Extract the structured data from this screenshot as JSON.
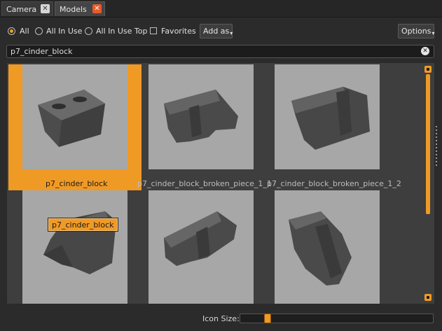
{
  "tabs": [
    {
      "label": "Camera",
      "close": "✕"
    },
    {
      "label": "Models",
      "close": "✕"
    }
  ],
  "filters": {
    "options": [
      {
        "label": "All",
        "selected": true
      },
      {
        "label": "All In Use",
        "selected": false
      },
      {
        "label": "All In Use Top",
        "selected": false
      }
    ],
    "favorites_label": "Favorites",
    "favorites_checked": false,
    "add_as_label": "Add as",
    "options_label": "Options"
  },
  "search": {
    "value": "p7_cinder_block",
    "clear_icon": "✕"
  },
  "models": [
    {
      "name": "p7_cinder_block",
      "selected": true
    },
    {
      "name": "p7_cinder_block_broken_piece_1_1",
      "selected": false
    },
    {
      "name": "p7_cinder_block_broken_piece_1_2",
      "selected": false
    },
    {
      "name": "",
      "selected": false
    },
    {
      "name": "",
      "selected": false
    },
    {
      "name": "",
      "selected": false
    }
  ],
  "tooltip": "p7_cinder_block",
  "icon_size": {
    "label": "Icon Size:",
    "value_fraction": 0.13
  },
  "scroll": {
    "position_fraction": 0.0
  },
  "colors": {
    "accent": "#f09a26",
    "close_active": "#e85a2a",
    "thumb_bg": "#a7a7a7",
    "panel_bg": "#2b2b2b"
  }
}
